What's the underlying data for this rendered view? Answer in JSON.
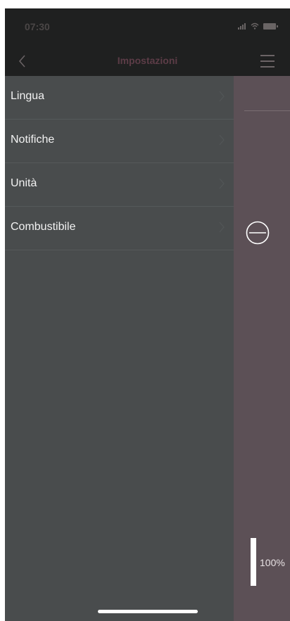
{
  "status_bar": {
    "time": "07:30",
    "icons": [
      "signal-icon",
      "wifi-icon",
      "battery-icon"
    ]
  },
  "nav": {
    "title": "Impostazioni",
    "back_icon": "chevron-left-icon",
    "menu_icon": "hamburger-menu-icon"
  },
  "settings": {
    "items": [
      {
        "label": "Lingua"
      },
      {
        "label": "Notifiche"
      },
      {
        "label": "Unità"
      },
      {
        "label": "Combustibile"
      }
    ]
  },
  "panel": {
    "level_text": "100%",
    "level_fraction": 1.0,
    "minus_icon": "minus-circle-icon"
  },
  "colors": {
    "drawer_bg": "#494c4d",
    "panel_bg": "#5c5056",
    "bar_bg": "#1f2020",
    "title_color": "#5c3c47"
  }
}
